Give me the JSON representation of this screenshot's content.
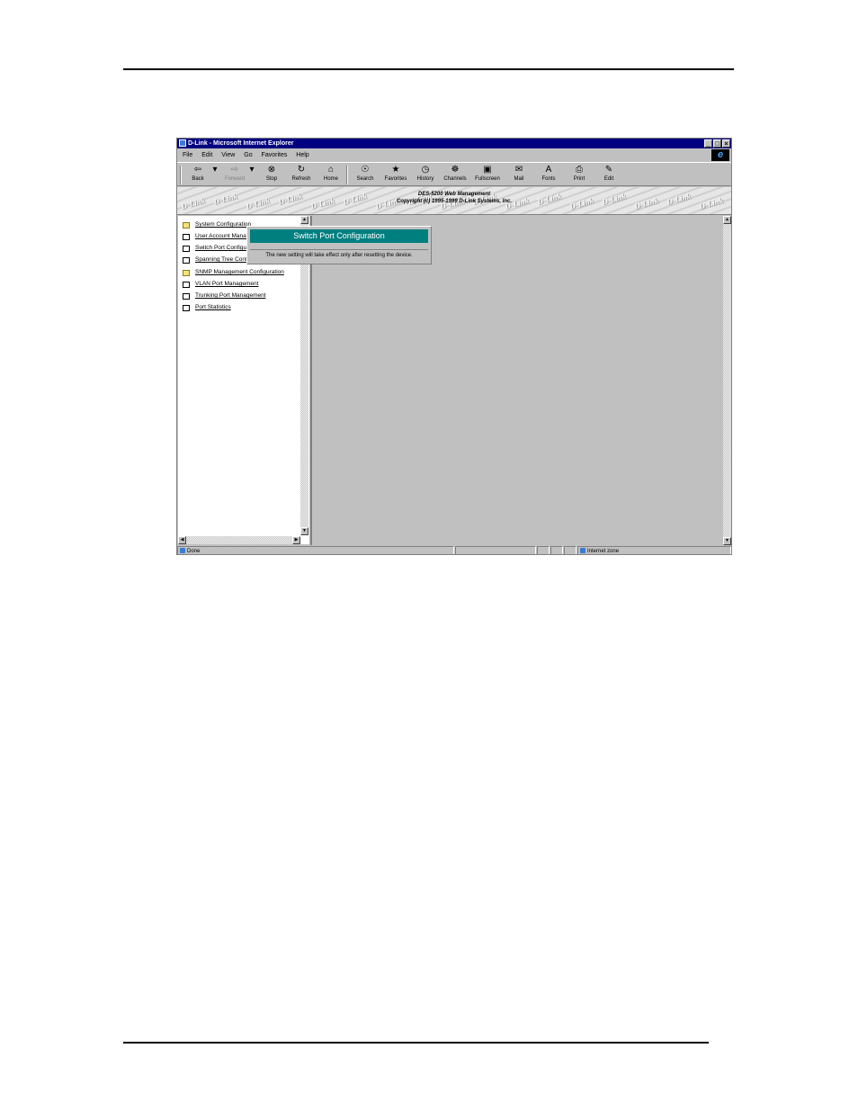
{
  "window": {
    "title": "D-Link - Microsoft Internet Explorer",
    "controls": {
      "minimize": "_",
      "maximize": "□",
      "close": "×"
    }
  },
  "menu": [
    "File",
    "Edit",
    "View",
    "Go",
    "Favorites",
    "Help"
  ],
  "toolbar": [
    {
      "label": "Back",
      "icon": "back-arrow-icon",
      "glyph": "⇦",
      "enabled": true
    },
    {
      "label": "Forward",
      "icon": "forward-arrow-icon",
      "glyph": "⇨",
      "enabled": false
    },
    {
      "label": "Stop",
      "icon": "stop-icon",
      "glyph": "⊗",
      "enabled": true
    },
    {
      "label": "Refresh",
      "icon": "refresh-icon",
      "glyph": "↻",
      "enabled": true
    },
    {
      "label": "Home",
      "icon": "home-icon",
      "glyph": "⌂",
      "enabled": true
    },
    {
      "label": "Search",
      "icon": "search-icon",
      "glyph": "☉",
      "enabled": true
    },
    {
      "label": "Favorites",
      "icon": "favorites-icon",
      "glyph": "★",
      "enabled": true
    },
    {
      "label": "History",
      "icon": "history-icon",
      "glyph": "◷",
      "enabled": true
    },
    {
      "label": "Channels",
      "icon": "channels-icon",
      "glyph": "☸",
      "enabled": true
    },
    {
      "label": "Fullscreen",
      "icon": "fullscreen-icon",
      "glyph": "▣",
      "enabled": true
    },
    {
      "label": "Mail",
      "icon": "mail-icon",
      "glyph": "✉",
      "enabled": true
    },
    {
      "label": "Fonts",
      "icon": "fonts-icon",
      "glyph": "A",
      "enabled": true
    },
    {
      "label": "Print",
      "icon": "print-icon",
      "glyph": "⎙",
      "enabled": true
    },
    {
      "label": "Edit",
      "icon": "edit-icon",
      "glyph": "✎",
      "enabled": true
    }
  ],
  "banner": {
    "title": "DES-5200 Web Management",
    "copyright": "Copyright (c) 1995-1999 D-Link Systems, Inc.",
    "watermark": "D-Link"
  },
  "nav": [
    {
      "label": "System Configuration",
      "icon": "folder"
    },
    {
      "label": "User Account Management",
      "icon": "doc"
    },
    {
      "label": "Switch Port Configuration",
      "icon": "doc"
    },
    {
      "label": "Spanning Tree Configuration",
      "icon": "doc"
    },
    {
      "label": "SNMP Management Configuration",
      "icon": "folder"
    },
    {
      "label": "VLAN Port Management",
      "icon": "doc"
    },
    {
      "label": "Trunking Port Management",
      "icon": "doc"
    },
    {
      "label": "Port Statistics",
      "icon": "doc"
    }
  ],
  "main": {
    "heading": "Switch Port Configuration",
    "note": "The new setting will take effect only after resetting the device."
  },
  "status": {
    "text": "Done",
    "zone": "Internet zone"
  },
  "colors": {
    "titlebar": "#000080",
    "heading_bg": "#007f7f"
  }
}
